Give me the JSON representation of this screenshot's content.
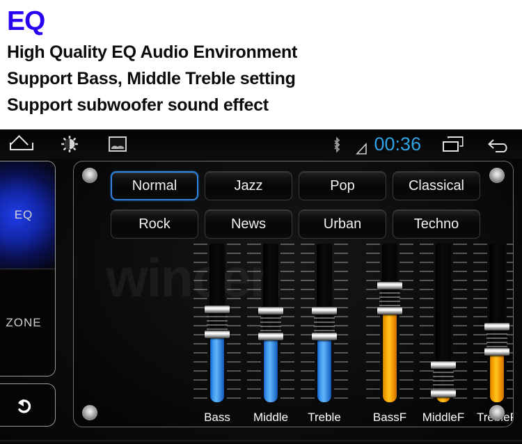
{
  "header": {
    "title": "EQ",
    "title_color": "#2a00f5",
    "features": [
      "High Quality EQ Audio Environment",
      "Support Bass, Middle Treble setting",
      "Support subwoofer sound effect"
    ]
  },
  "status_bar": {
    "left_icons": [
      {
        "name": "home-icon",
        "label": "Home"
      },
      {
        "name": "brightness-icon",
        "label": "Brightness"
      },
      {
        "name": "wallpaper-icon",
        "label": "Wallpaper"
      }
    ],
    "bluetooth_icon": "bluetooth-icon",
    "signal_icon": "signal-icon",
    "clock": "00:36",
    "clock_color": "#2ea3e8",
    "recents_icon": "recent-apps-icon",
    "back_icon": "back-icon"
  },
  "sidebar": {
    "items": [
      {
        "label": "EQ",
        "active": true
      },
      {
        "label": "ZONE",
        "active": false
      }
    ],
    "back_button": {
      "icon": "undo-arrow-icon",
      "label": "Back"
    }
  },
  "panel": {
    "watermark": "wincen",
    "screws": [
      "screw-top-left",
      "screw-top-right",
      "screw-bottom-left",
      "screw-bottom-right"
    ],
    "presets": [
      {
        "label": "Normal",
        "selected": true
      },
      {
        "label": "Jazz",
        "selected": false
      },
      {
        "label": "Pop",
        "selected": false
      },
      {
        "label": "Classical",
        "selected": false
      },
      {
        "label": "Rock",
        "selected": false
      },
      {
        "label": "News",
        "selected": false
      },
      {
        "label": "Urban",
        "selected": false
      },
      {
        "label": "Techno",
        "selected": false
      }
    ],
    "accent_selected": "#2e86e6",
    "sliders": [
      {
        "label": "Bass",
        "color": "blue",
        "fill_hex": "#3f9bf0",
        "handle_top_pct": 39,
        "handle_bottom_pct": 55,
        "fill_from_pct": 55
      },
      {
        "label": "Middle",
        "color": "blue",
        "fill_hex": "#3f9bf0",
        "handle_top_pct": 40,
        "handle_bottom_pct": 56,
        "fill_from_pct": 56
      },
      {
        "label": "Treble",
        "color": "blue",
        "fill_hex": "#3f9bf0",
        "handle_top_pct": 40,
        "handle_bottom_pct": 56,
        "fill_from_pct": 56
      },
      {
        "label": "BassF",
        "color": "orange",
        "fill_hex": "#ffc31f",
        "handle_top_pct": 24,
        "handle_bottom_pct": 40,
        "fill_from_pct": 40
      },
      {
        "label": "MiddleF",
        "color": "orange",
        "fill_hex": "#ffc31f",
        "handle_top_pct": 74,
        "handle_bottom_pct": 92,
        "fill_from_pct": 92
      },
      {
        "label": "TrebleF",
        "color": "orange",
        "fill_hex": "#ffc31f",
        "handle_top_pct": 50,
        "handle_bottom_pct": 66,
        "fill_from_pct": 66
      }
    ]
  }
}
